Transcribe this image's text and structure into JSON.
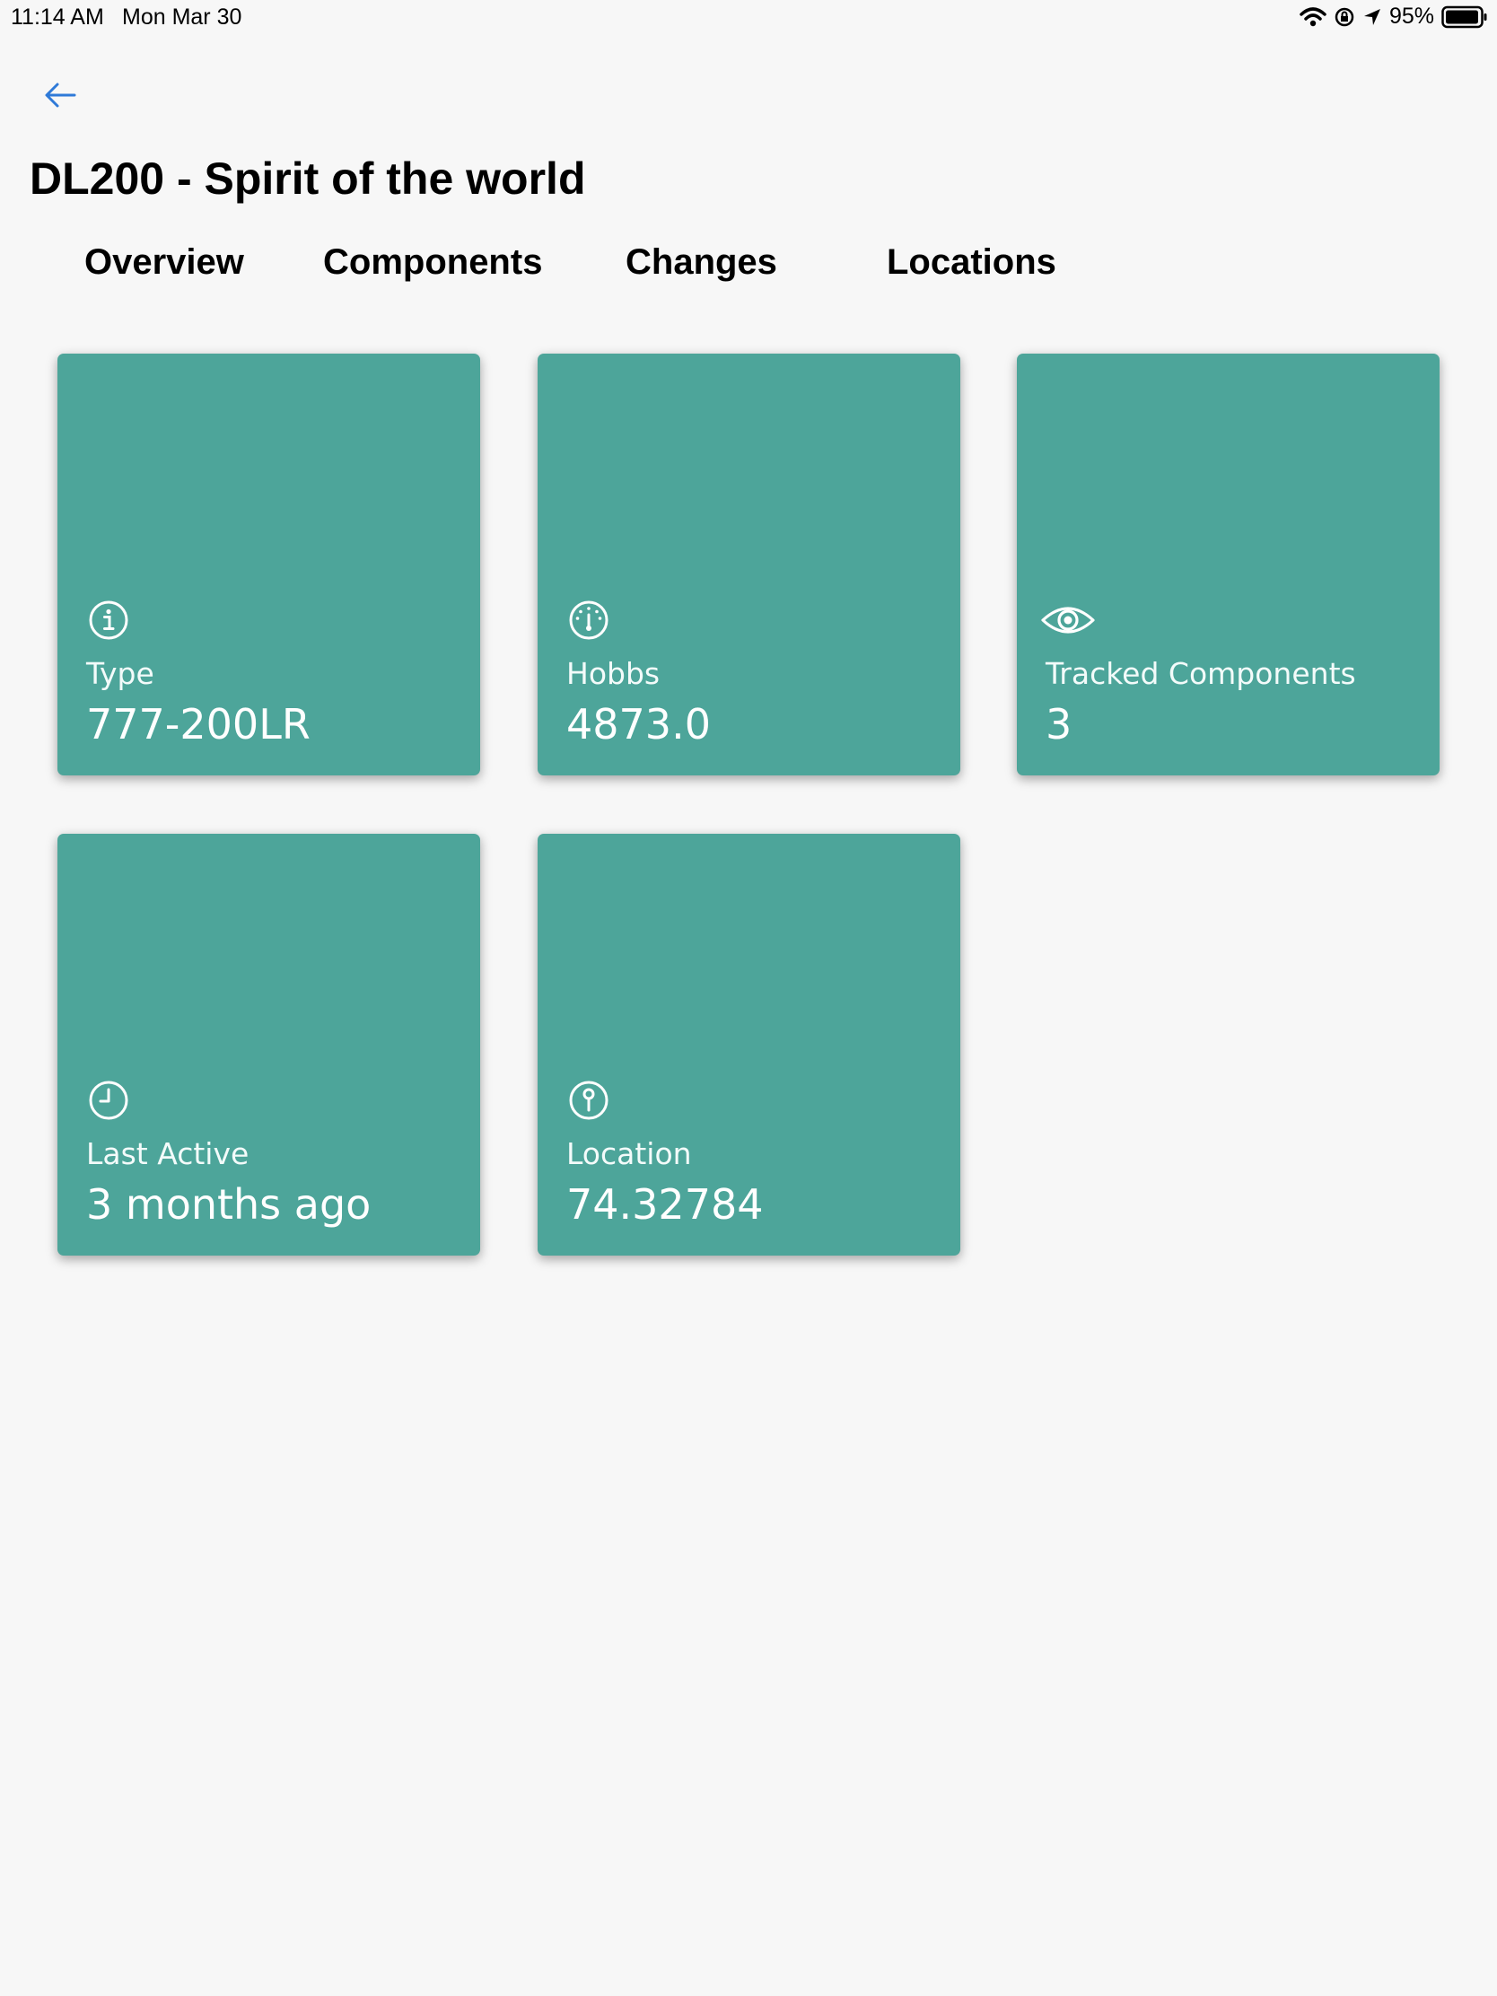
{
  "status_bar": {
    "time": "11:14 AM",
    "date": "Mon Mar 30",
    "battery_percent": "95%"
  },
  "header": {
    "back_icon": "arrow-left-icon",
    "title": "DL200 - Spirit of the world"
  },
  "tabs": [
    {
      "label": "Overview"
    },
    {
      "label": "Components"
    },
    {
      "label": "Changes"
    },
    {
      "label": "Locations"
    }
  ],
  "colors": {
    "card_background": "#4da59a",
    "page_background": "#f7f7f7",
    "accent": "#2f7ad8"
  },
  "cards": [
    {
      "icon": "info-icon",
      "label": "Type",
      "value": "777-200LR"
    },
    {
      "icon": "gauge-icon",
      "label": "Hobbs",
      "value": "4873.0"
    },
    {
      "icon": "eye-icon",
      "label": "Tracked Components",
      "value": "3"
    },
    {
      "icon": "clock-icon",
      "label": "Last Active",
      "value": "3 months ago"
    },
    {
      "icon": "pin-icon",
      "label": "Location",
      "value": "74.32784"
    }
  ]
}
